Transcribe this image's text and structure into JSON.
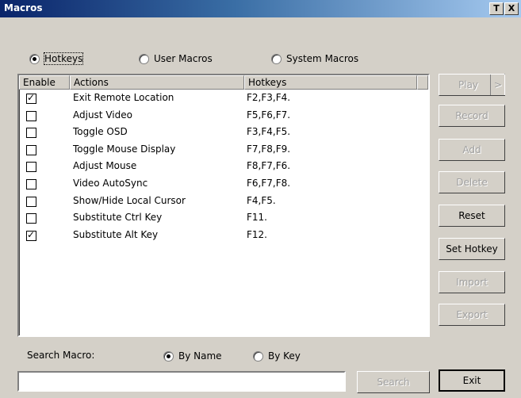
{
  "window": {
    "title": "Macros",
    "title_btn_t": "T",
    "title_btn_x": "X"
  },
  "tabs": {
    "hotkeys": "Hotkeys",
    "user_macros": "User Macros",
    "system_macros": "System Macros",
    "selected": "Hotkeys"
  },
  "list": {
    "headers": {
      "enable": "Enable",
      "actions": "Actions",
      "hotkeys": "Hotkeys"
    },
    "rows": [
      {
        "enabled": true,
        "action": "Exit Remote Location",
        "hotkeys": "F2,F3,F4."
      },
      {
        "enabled": false,
        "action": "Adjust Video",
        "hotkeys": "F5,F6,F7."
      },
      {
        "enabled": false,
        "action": "Toggle OSD",
        "hotkeys": "F3,F4,F5."
      },
      {
        "enabled": false,
        "action": "Toggle Mouse Display",
        "hotkeys": "F7,F8,F9."
      },
      {
        "enabled": false,
        "action": "Adjust Mouse",
        "hotkeys": "F8,F7,F6."
      },
      {
        "enabled": false,
        "action": "Video AutoSync",
        "hotkeys": "F6,F7,F8."
      },
      {
        "enabled": false,
        "action": "Show/Hide Local Cursor",
        "hotkeys": "F4,F5."
      },
      {
        "enabled": false,
        "action": "Substitute Ctrl Key",
        "hotkeys": "F11."
      },
      {
        "enabled": true,
        "action": "Substitute Alt Key",
        "hotkeys": "F12."
      }
    ]
  },
  "buttons": {
    "play": "Play",
    "play_arrow": ">",
    "record": "Record",
    "add": "Add",
    "delete": "Delete",
    "reset": "Reset",
    "set_hotkey": "Set Hotkey",
    "import": "Import",
    "export": "Export",
    "search": "Search",
    "exit": "Exit"
  },
  "search": {
    "label": "Search Macro:",
    "by_name": "By Name",
    "by_key": "By Key",
    "selected": "By Name",
    "value": ""
  }
}
